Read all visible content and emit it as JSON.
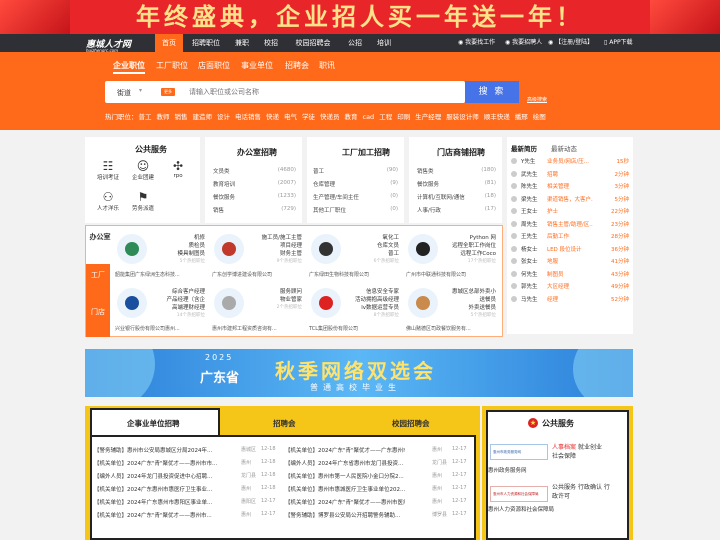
{
  "banner": {
    "text": "年终盛典，企业招人买一年送一年！"
  },
  "site": {
    "logo": "惠城人才网",
    "logo_sub": "huizhengrc.com"
  },
  "nav": {
    "items": [
      "首页",
      "招聘职位",
      "兼职",
      "校招",
      "校园招聘会",
      "公招",
      "培训"
    ],
    "right": [
      "我要找工作",
      "我要招聘人",
      "【注册/登陆】",
      "APP下载"
    ]
  },
  "tabs": [
    "企业职位",
    "工厂职位",
    "店面职位",
    "事业单位",
    "招聘会",
    "职讯"
  ],
  "search": {
    "city": "街道",
    "badge": "更多",
    "placeholder": "请输入职位或公司名称",
    "button": "搜 索",
    "advanced": "高级搜索"
  },
  "hot": {
    "label": "热门职位：",
    "items": [
      "普工",
      "教师",
      "销售",
      "建造师",
      "设计",
      "电话销售",
      "快递",
      "电气",
      "学徒",
      "快递员",
      "教育",
      "cad",
      "工程",
      "印刷",
      "生产经理",
      "服装设计师",
      "顺丰快递",
      "播邢",
      "绘图"
    ]
  },
  "public_service": {
    "title": "公共服务",
    "items": [
      {
        "label": "培训考证",
        "icon": "certificate-icon"
      },
      {
        "label": "企业团建",
        "icon": "team-icon"
      },
      {
        "label": "rpo",
        "icon": "rpo-icon"
      },
      {
        "label": "人才洋乐",
        "icon": "talent-icon"
      },
      {
        "label": "劳务派遣",
        "icon": "dispatch-icon"
      }
    ]
  },
  "cat_office": {
    "title": "办公室招聘",
    "jobs": [
      {
        "name": "文员类",
        "count": "(4680)"
      },
      {
        "name": "教育培训",
        "count": "(2007)"
      },
      {
        "name": "餐饮服务",
        "count": "(1233)"
      },
      {
        "name": "销售",
        "count": "(729)"
      }
    ]
  },
  "cat_factory": {
    "title": "工厂加工招聘",
    "jobs": [
      {
        "name": "普工",
        "count": "(90)"
      },
      {
        "name": "仓库管理",
        "count": "(9)"
      },
      {
        "name": "生产管理/车间主任",
        "count": "(0)"
      },
      {
        "name": "其他工厂职位",
        "count": "(0)"
      }
    ]
  },
  "cat_shop": {
    "title": "门店商铺招聘",
    "jobs": [
      {
        "name": "销售类",
        "count": "(180)"
      },
      {
        "name": "餐饮服务",
        "count": "(81)"
      },
      {
        "name": "计算机/互联网/通信",
        "count": "(18)"
      },
      {
        "name": "人事/行政",
        "count": "(17)"
      }
    ]
  },
  "feed": {
    "tabs": [
      "最新简历",
      "最新动态"
    ],
    "rows": [
      {
        "name": "Y先生",
        "job": "业务员/网店/压...",
        "time": "15秒"
      },
      {
        "name": "武先生",
        "job": "招聘",
        "time": "2分钟"
      },
      {
        "name": "陈先生",
        "job": "相关管理",
        "time": "3分钟"
      },
      {
        "name": "梁先生",
        "job": "渠道销售，大客户...",
        "time": "5分钟"
      },
      {
        "name": "王女士",
        "job": "护士",
        "time": "22分钟"
      },
      {
        "name": "周先生",
        "job": "销售主管/助理/区...",
        "time": "23分钟"
      },
      {
        "name": "王先生",
        "job": "后勤工作",
        "time": "28分钟"
      },
      {
        "name": "杨女士",
        "job": "LED 段位设计",
        "time": "36分钟"
      },
      {
        "name": "张女士",
        "job": "地服",
        "time": "41分钟"
      },
      {
        "name": "何先生",
        "job": "制图员",
        "time": "43分钟"
      },
      {
        "name": "郭先生",
        "job": "大区经理",
        "time": "49分钟"
      },
      {
        "name": "马先生",
        "job": "经理",
        "time": "52分钟"
      }
    ]
  },
  "company_tags": [
    "办公室",
    "工厂",
    "门店"
  ],
  "companies": [
    {
      "jobs": [
        "机修",
        "质检员",
        "模具制图员"
      ],
      "more": "5个热招职位",
      "name": "韶能集团广东绿洲生态科技..."
    },
    {
      "jobs": [
        "施工员/施工主管",
        "项目经理",
        "财务主管"
      ],
      "more": "9个热招职位",
      "name": "广东创学博进建设有限公司"
    },
    {
      "jobs": [
        "氧化工",
        "仓库文员",
        "普工"
      ],
      "more": "6个热招职位",
      "name": "广东绿田生物科技有限公司"
    },
    {
      "jobs": [
        "Python 网",
        "远程全职工作岗位",
        "远程工作Coco"
      ],
      "more": "17个热招职位",
      "name": "广州市中联通科技有限公司"
    },
    {
      "jobs": [
        "综合客户经理",
        "产品经理（含企",
        "高端理财经理"
      ],
      "more": "14个热招职位",
      "name": "兴业银行股份有限公司惠州..."
    },
    {
      "jobs": [
        "服务顾问",
        "物业管家"
      ],
      "more": "2个热招职位",
      "name": "惠州市建邦工程资质咨询有..."
    },
    {
      "jobs": [
        "信息安全专家",
        "活动拥抱高级经理",
        "lv数据运营专员"
      ],
      "more": "8个热招职位",
      "name": "TCL集团股份有限公司"
    },
    {
      "jobs": [
        "惠城区总部外卖小",
        "送餐员",
        "外卖送餐员"
      ],
      "more": "5个热招职位",
      "name": "佛山赌德区司政餐饮服务有..."
    }
  ],
  "promo": {
    "year": "2025",
    "province": "广东省",
    "title": "秋季网络双选会",
    "subtitle": "普通高校毕业生"
  },
  "recruit": {
    "tabs": [
      "企事业单位招聘",
      "招聘会",
      "校园招聘会"
    ],
    "left": [
      {
        "title": "【警务辅助】惠州市公安局惠城区分局2024年...",
        "area": "惠城区",
        "date": "12-18"
      },
      {
        "title": "【机关单位】2024广东\"青\"聚优才——惠州市市...",
        "area": "惠州",
        "date": "12-18"
      },
      {
        "title": "【编外人员】2024年龙门县投资促进中心招聘...",
        "area": "龙门县",
        "date": "12-18"
      },
      {
        "title": "【机关单位】2024广东惠州市惠医疗卫生事业...",
        "area": "惠州",
        "date": "12-18"
      },
      {
        "title": "【机关单位】2024年广东惠州市惠阳区事业单...",
        "area": "惠阳区",
        "date": "12-17"
      },
      {
        "title": "【机关单位】2024广东\"青\"聚优才——惠州市...",
        "area": "惠州",
        "date": "12-17"
      }
    ],
    "right": [
      {
        "title": "【机关单位】2024广东\"青\"聚优才——广东惠州市市...",
        "area": "惠州",
        "date": "12-17"
      },
      {
        "title": "【编外人员】2024年广东省惠州市龙门县投资...",
        "area": "龙门县",
        "date": "12-17"
      },
      {
        "title": "【机关单位】惠州市第一人民医院小金口分院2...",
        "area": "惠州",
        "date": "12-17"
      },
      {
        "title": "【机关单位】惠州市惠城医疗卫生事业单位202...",
        "area": "惠州",
        "date": "12-17"
      },
      {
        "title": "【机关单位】2024广东\"青\"聚优才——惠州市医疗...",
        "area": "惠州",
        "date": "12-17"
      },
      {
        "title": "【警务辅助】博罗县公安局公开招聘警务辅助...",
        "area": "博罗县",
        "date": "12-17"
      }
    ]
  },
  "pubsvc": {
    "title": "公共服务",
    "items": [
      {
        "logo": "惠州市政务服务网",
        "links": [
          "人事档案",
          "就业创业",
          "社会保障"
        ],
        "name": "惠州政务服务网"
      },
      {
        "logo": "惠州市人力资源和社会保障局",
        "links": [
          "公共服务",
          "行政确认",
          "行政许可"
        ],
        "name": "惠州人力资源和社会保障局"
      }
    ]
  },
  "colors": {
    "accent": "#ff6a1a",
    "banner_red": "#e8262a",
    "nav_dark": "#2f3035",
    "search_blue": "#4673e8",
    "recruit_yellow": "#f5c518"
  }
}
